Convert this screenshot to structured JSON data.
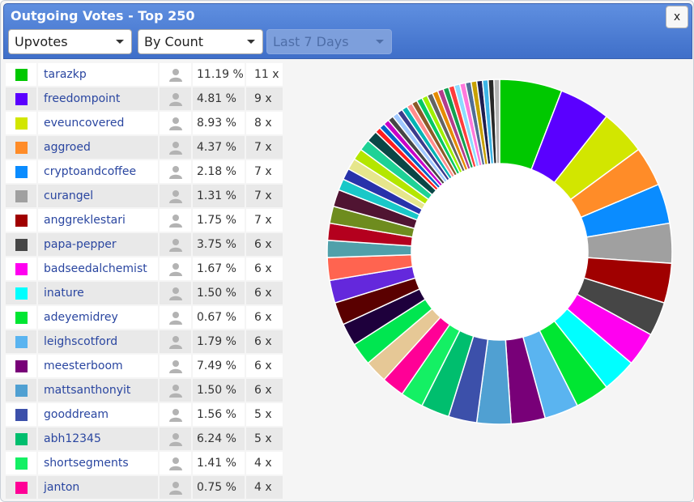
{
  "window": {
    "title": "Outgoing Votes - Top 250",
    "close_label": "x"
  },
  "controls": {
    "vote_type": "Upvotes",
    "sort_by": "By Count",
    "period": "Last 7 Days"
  },
  "rows": [
    {
      "name": "tarazkp",
      "pct": "11.19 %",
      "count": "11 x",
      "color": "#00c800"
    },
    {
      "name": "freedompoint",
      "pct": "4.81 %",
      "count": "9 x",
      "color": "#5a00ff"
    },
    {
      "name": "eveuncovered",
      "pct": "8.93 %",
      "count": "8 x",
      "color": "#d2e600"
    },
    {
      "name": "aggroed",
      "pct": "4.37 %",
      "count": "7 x",
      "color": "#ff8c28"
    },
    {
      "name": "cryptoandcoffee",
      "pct": "2.18 %",
      "count": "7 x",
      "color": "#0a8cff"
    },
    {
      "name": "curangel",
      "pct": "1.31 %",
      "count": "7 x",
      "color": "#a0a0a0"
    },
    {
      "name": "anggreklestari",
      "pct": "1.75 %",
      "count": "7 x",
      "color": "#a00000"
    },
    {
      "name": "papa-pepper",
      "pct": "3.75 %",
      "count": "6 x",
      "color": "#464646"
    },
    {
      "name": "badseedalchemist",
      "pct": "1.67 %",
      "count": "6 x",
      "color": "#ff00f0"
    },
    {
      "name": "inature",
      "pct": "1.50 %",
      "count": "6 x",
      "color": "#00ffff"
    },
    {
      "name": "adeyemidrey",
      "pct": "0.67 %",
      "count": "6 x",
      "color": "#00e632"
    },
    {
      "name": "leighscotford",
      "pct": "1.79 %",
      "count": "6 x",
      "color": "#5ab4f0"
    },
    {
      "name": "meesterboom",
      "pct": "7.49 %",
      "count": "6 x",
      "color": "#780078"
    },
    {
      "name": "mattsanthonyit",
      "pct": "1.50 %",
      "count": "6 x",
      "color": "#50a0d2"
    },
    {
      "name": "gooddream",
      "pct": "1.56 %",
      "count": "5 x",
      "color": "#3c50aa"
    },
    {
      "name": "abh12345",
      "pct": "6.24 %",
      "count": "5 x",
      "color": "#00be6e"
    },
    {
      "name": "shortsegments",
      "pct": "1.41 %",
      "count": "4 x",
      "color": "#14f064"
    },
    {
      "name": "janton",
      "pct": "0.75 %",
      "count": "4 x",
      "color": "#ff0096"
    }
  ],
  "chart_data": {
    "type": "pie",
    "style": "donut",
    "start": "12 o'clock",
    "direction": "clockwise",
    "slices": [
      {
        "label": "tarazkp",
        "value": 11,
        "color": "#00c800"
      },
      {
        "label": "freedompoint",
        "value": 9,
        "color": "#5a00ff"
      },
      {
        "label": "eveuncovered",
        "value": 8,
        "color": "#d2e600"
      },
      {
        "label": "aggroed",
        "value": 7,
        "color": "#ff8c28"
      },
      {
        "label": "cryptoandcoffee",
        "value": 7,
        "color": "#0a8cff"
      },
      {
        "label": "curangel",
        "value": 7,
        "color": "#a0a0a0"
      },
      {
        "label": "anggreklestari",
        "value": 7,
        "color": "#a00000"
      },
      {
        "label": "papa-pepper",
        "value": 6,
        "color": "#464646"
      },
      {
        "label": "badseedalchemist",
        "value": 6,
        "color": "#ff00f0"
      },
      {
        "label": "inature",
        "value": 6,
        "color": "#00ffff"
      },
      {
        "label": "adeyemidrey",
        "value": 6,
        "color": "#00e632"
      },
      {
        "label": "leighscotford",
        "value": 6,
        "color": "#5ab4f0"
      },
      {
        "label": "meesterboom",
        "value": 6,
        "color": "#780078"
      },
      {
        "label": "mattsanthonyit",
        "value": 6,
        "color": "#50a0d2"
      },
      {
        "label": "gooddream",
        "value": 5,
        "color": "#3c50aa"
      },
      {
        "label": "abh12345",
        "value": 5,
        "color": "#00be6e"
      },
      {
        "label": "shortsegments",
        "value": 4,
        "color": "#14f064"
      },
      {
        "label": "janton",
        "value": 4,
        "color": "#ff0096"
      },
      {
        "value": 4,
        "color": "#e6c896"
      },
      {
        "value": 4,
        "color": "#00e650"
      },
      {
        "value": 4,
        "color": "#1e003c"
      },
      {
        "value": 4,
        "color": "#5a0000"
      },
      {
        "value": 4,
        "color": "#6428dc"
      },
      {
        "value": 4,
        "color": "#ff6450"
      },
      {
        "value": 3,
        "color": "#50a0aa"
      },
      {
        "value": 3,
        "color": "#b4001e"
      },
      {
        "value": 3,
        "color": "#6e8c1e"
      },
      {
        "value": 3,
        "color": "#501432"
      },
      {
        "value": 2,
        "color": "#19c8c8"
      },
      {
        "value": 2,
        "color": "#2832aa"
      },
      {
        "value": 2,
        "color": "#e6e68c"
      },
      {
        "value": 2,
        "color": "#b4e600"
      },
      {
        "value": 2,
        "color": "#1ed296"
      },
      {
        "value": 2,
        "color": "#0a4646"
      },
      {
        "value": 1,
        "color": "#ff1e1e"
      },
      {
        "value": 1,
        "color": "#0064c8"
      },
      {
        "value": 1,
        "color": "#c800c8"
      },
      {
        "value": 1,
        "color": "#464646"
      },
      {
        "value": 1,
        "color": "#a0c8ff"
      },
      {
        "value": 1,
        "color": "#3c3c8c"
      },
      {
        "value": 1,
        "color": "#00b4b4"
      },
      {
        "value": 1,
        "color": "#ff8c8c"
      },
      {
        "value": 1,
        "color": "#8c5a28"
      },
      {
        "value": 1,
        "color": "#00c864"
      },
      {
        "value": 1,
        "color": "#a0f000"
      },
      {
        "value": 1,
        "color": "#646464"
      },
      {
        "value": 1,
        "color": "#e68c00"
      },
      {
        "value": 1,
        "color": "#b43c8c"
      },
      {
        "value": 1,
        "color": "#14a050"
      },
      {
        "value": 1,
        "color": "#ff3c3c"
      },
      {
        "value": 1,
        "color": "#8cdcff"
      },
      {
        "value": 1,
        "color": "#ff78dc"
      },
      {
        "value": 1,
        "color": "#506e96"
      },
      {
        "value": 1,
        "color": "#c8a000"
      },
      {
        "value": 1,
        "color": "#1e1e50"
      },
      {
        "value": 1,
        "color": "#3cb4e6"
      },
      {
        "value": 1,
        "color": "#282828"
      },
      {
        "value": 1,
        "color": "#b4b4b4"
      }
    ]
  },
  "icons": {
    "avatar": "user-silhouette-icon",
    "dropdown": "caret-down-icon"
  }
}
